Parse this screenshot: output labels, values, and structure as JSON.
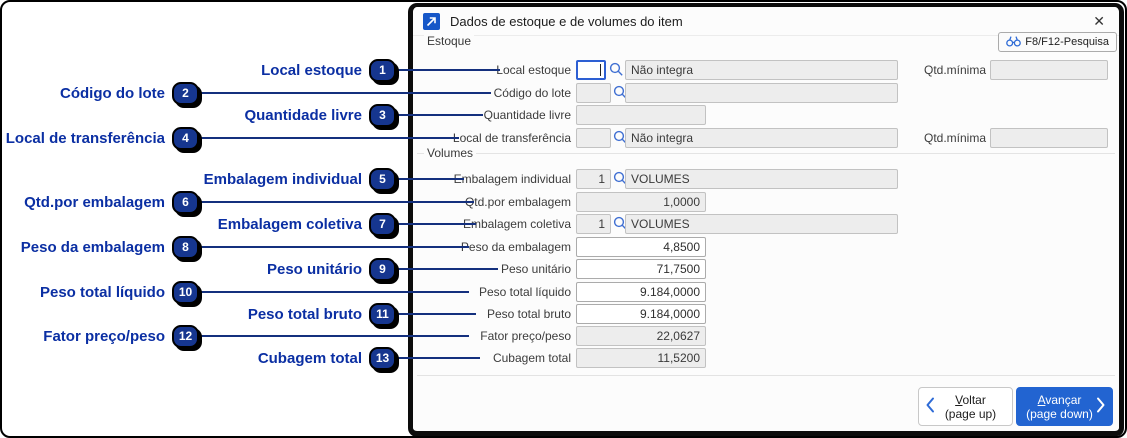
{
  "colors": {
    "accent_blue": "#2264D1",
    "callout_navy": "#16368F",
    "focus_border_blue": "#2D5FD3",
    "disabled_field_bg": "#EDEDED",
    "dialog_border": "#0C0C0C"
  },
  "window": {
    "title": "Dados de estoque e de volumes do item",
    "icon": "arrow-up-right-icon",
    "close_glyph": "✕",
    "search_button_label": "F8/F12-Pesquisa"
  },
  "groups": {
    "estoque_label": "Estoque",
    "volumes_label": "Volumes"
  },
  "labels": {
    "qtd_minima": "Qtd.mínima"
  },
  "fields": [
    {
      "label": "Local estoque",
      "code": "",
      "desc": "Não integra",
      "qtd": ""
    },
    {
      "label": "Código do lote",
      "code": "",
      "desc": ""
    },
    {
      "label": "Quantidade livre",
      "value": ""
    },
    {
      "label": "Local de transferência",
      "code": "",
      "desc": "Não integra",
      "qtd": ""
    },
    {
      "label": "Embalagem individual",
      "code": "1",
      "desc": "VOLUMES"
    },
    {
      "label": "Qtd.por embalagem",
      "value": "1,0000"
    },
    {
      "label": "Embalagem coletiva",
      "code": "1",
      "desc": "VOLUMES"
    },
    {
      "label": "Peso da embalagem",
      "value": "4,8500"
    },
    {
      "label": "Peso unitário",
      "value": "71,7500"
    },
    {
      "label": "Peso total líquido",
      "value": "9.184,0000"
    },
    {
      "label": "Peso total bruto",
      "value": "9.184,0000"
    },
    {
      "label": "Fator preço/peso",
      "value": "22,0627"
    },
    {
      "label": "Cubagem total",
      "value": "11,5200"
    }
  ],
  "buttons": {
    "voltar": {
      "key": "V",
      "rest": "oltar",
      "sub": "(page up)"
    },
    "avancar": {
      "key": "A",
      "rest": "vançar",
      "sub": "(page down)"
    }
  },
  "callouts": [
    {
      "num": "1",
      "label": "Local estoque"
    },
    {
      "num": "2",
      "label": "Código do lote"
    },
    {
      "num": "3",
      "label": "Quantidade livre"
    },
    {
      "num": "4",
      "label": "Local de transferência"
    },
    {
      "num": "5",
      "label": "Embalagem individual"
    },
    {
      "num": "6",
      "label": "Qtd.por embalagem"
    },
    {
      "num": "7",
      "label": "Embalagem coletiva"
    },
    {
      "num": "8",
      "label": "Peso da embalagem"
    },
    {
      "num": "9",
      "label": "Peso unitário"
    },
    {
      "num": "10",
      "label": "Peso total líquido"
    },
    {
      "num": "11",
      "label": "Peso total bruto"
    },
    {
      "num": "12",
      "label": "Fator preço/peso"
    },
    {
      "num": "13",
      "label": "Cubagem total"
    }
  ]
}
